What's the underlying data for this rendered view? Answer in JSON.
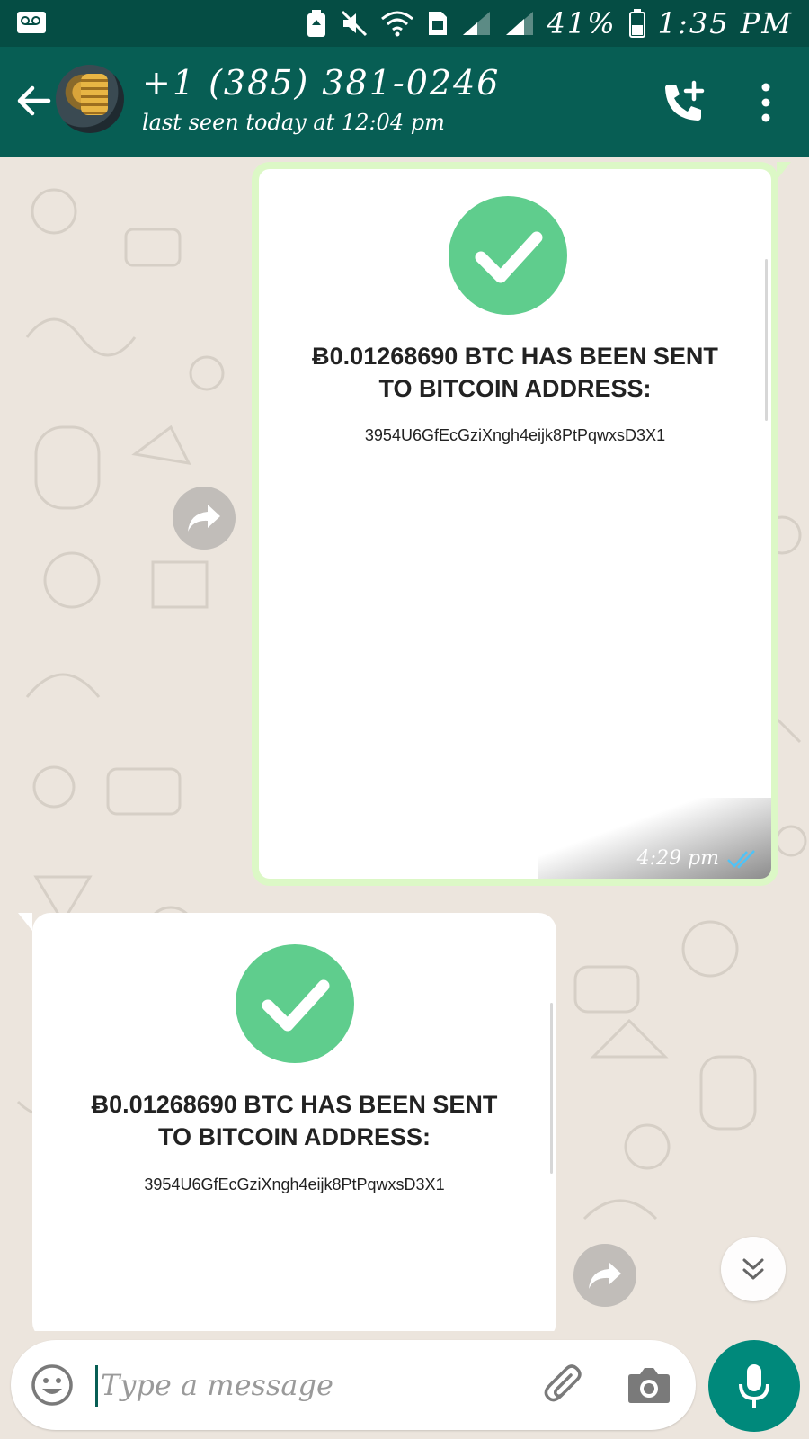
{
  "status_bar": {
    "battery": "41%",
    "time": "1:35 PM"
  },
  "header": {
    "contact": "+1 (385) 381-0246",
    "last_seen": "last seen today at 12:04 pm"
  },
  "messages": [
    {
      "direction": "outgoing",
      "amount": "Ƀ0.01268690 BTC HAS BEEN SENT",
      "amount_line2": "TO BITCOIN ADDRESS:",
      "address": "3954U6GfEcGziXngh4eijk8PtPqwxsD3X1",
      "time": "4:29 pm",
      "receipt": "read"
    },
    {
      "direction": "incoming",
      "amount": "Ƀ0.01268690 BTC HAS BEEN SENT",
      "amount_line2": "TO BITCOIN ADDRESS:",
      "address": "3954U6GfEcGziXngh4eijk8PtPqwxsD3X1"
    }
  ],
  "composer": {
    "placeholder": "Type a message"
  },
  "colors": {
    "header": "#075e54",
    "status_bar": "#054d44",
    "outgoing_bubble": "#dcf8c6",
    "check_circle": "#5fcd8d",
    "mic_button": "#00897b",
    "read_ticks": "#4fc3f7"
  }
}
